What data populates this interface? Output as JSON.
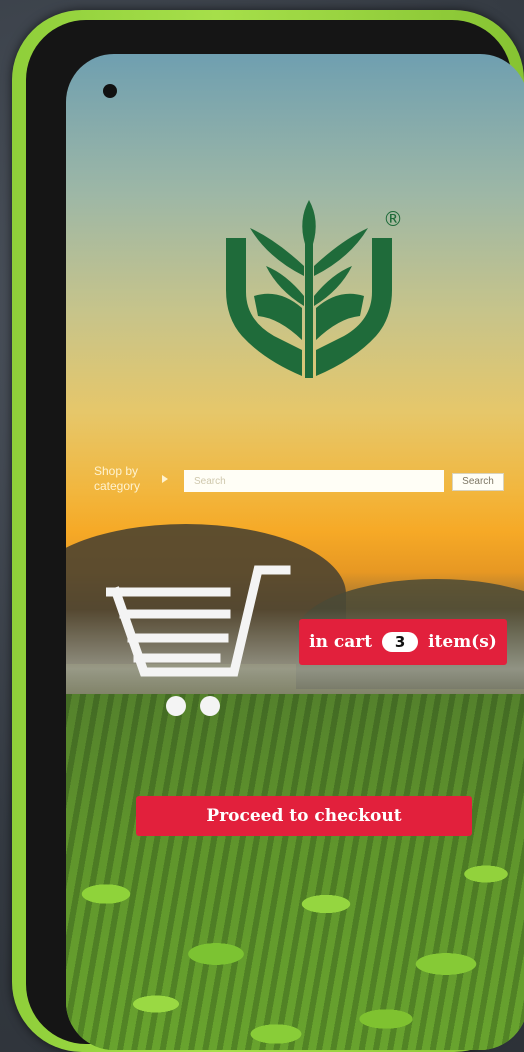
{
  "search": {
    "category_label": "Shop by category",
    "placeholder": "Search",
    "button_label": "Search"
  },
  "logo": {
    "registered_mark": "®",
    "brand_color": "#1f6b3a"
  },
  "cart": {
    "prefix": "in cart",
    "count": "3",
    "suffix": "item(s)"
  },
  "checkout": {
    "label": "Proceed to checkout"
  },
  "colors": {
    "accent": "#e2203c",
    "case": "#a6df4a"
  },
  "icons": [
    "logo-icon",
    "cart-icon",
    "camera-icon"
  ]
}
